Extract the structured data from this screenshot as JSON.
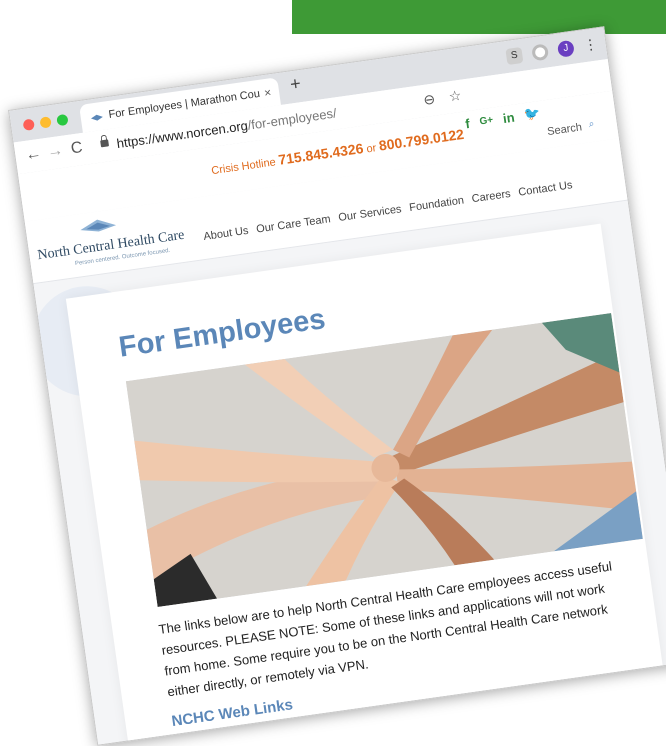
{
  "browser": {
    "tab_title": "For Employees | Marathon Cou",
    "tab_close": "×",
    "new_tab": "+",
    "s_button": "S",
    "profile_initial": "J",
    "kebab": "⋮",
    "back": "←",
    "forward": "→",
    "reload": "C",
    "url_domain": "https://www.norcen.org",
    "url_path": "/for-employees/",
    "zoom_icon": "⊖",
    "star_icon": "☆"
  },
  "utility": {
    "crisis_label": "Crisis Hotline",
    "phone_1": "715.845.4326",
    "or": "or",
    "phone_2": "800.799.0122",
    "search_label": "Search",
    "social": {
      "fb": "f",
      "gplus": "G+",
      "linkedin": "in",
      "twitter": "🐦"
    }
  },
  "header": {
    "logo_name": "North Central Health Care",
    "logo_tagline": "Person centered. Outcome focused.",
    "menu": [
      "About Us",
      "Our Care Team",
      "Our Services",
      "Foundation",
      "Careers",
      "Contact Us"
    ]
  },
  "content": {
    "title": "For Employees",
    "body": "The links below are to help North Central Health Care employees access useful resources. PLEASE NOTE: Some of these links and applications will not work from home. Some require you to be on the North Central Health Care network either directly, or remotely via VPN.",
    "section_title": "NCHC Web Links"
  },
  "colors": {
    "brand_green": "#3e9a36",
    "title_blue": "#5b87b8",
    "crisis_orange": "#e06b1e"
  }
}
